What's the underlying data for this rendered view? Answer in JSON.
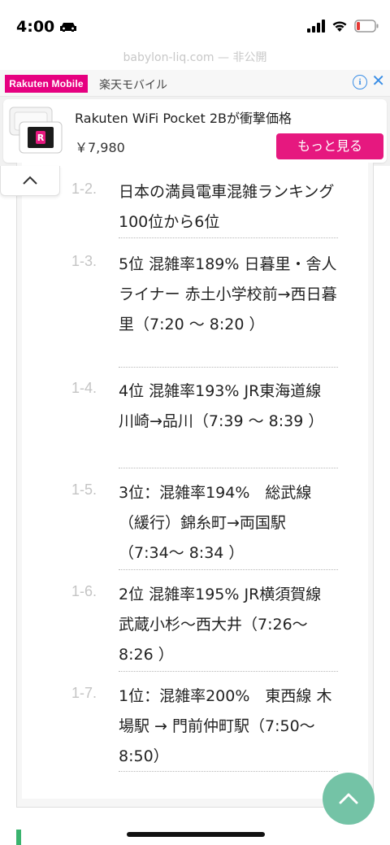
{
  "status_bar": {
    "time": "4:00"
  },
  "url_text": "babylon-liq.com — 非公開",
  "ad": {
    "logo": "Rakuten Mobile",
    "brand": "楽天モバイル",
    "info_icon": "i",
    "close_icon": "✕",
    "title": "Rakuten WiFi Pocket 2Bが衝撃価格",
    "price": "￥7,980",
    "cta": "もっと見る",
    "accent": "#e6187f"
  },
  "toc": {
    "items": [
      {
        "num": "1-2.",
        "text": "日本の満員電車混雑ランキング100位から6位"
      },
      {
        "num": "1-3.",
        "text": "5位 混雑率189% 日暮里・舎人ライナー 赤土小学校前→西日暮里（7:20 〜 8:20 ）"
      },
      {
        "num": "1-4.",
        "text": "4位 混雑率193% JR東海道線 川崎→品川（7:39 〜 8:39 ）"
      },
      {
        "num": "1-5.",
        "text": "3位：混雑率194%　総武線（緩行）錦糸町→両国駅（7:34〜 8:34 ）"
      },
      {
        "num": "1-6.",
        "text": "2位 混雑率195% JR横須賀線 武蔵小杉〜西大井（7:26〜 8:26 ）"
      },
      {
        "num": "1-7.",
        "text": "1位：混雑率200%　東西線 木場駅 → 門前仲町駅（7:50〜 8:50）"
      }
    ]
  },
  "colors": {
    "scroll_top": "#74c3a6",
    "num": "#c4c4c4",
    "marker": "#3ab36e"
  }
}
